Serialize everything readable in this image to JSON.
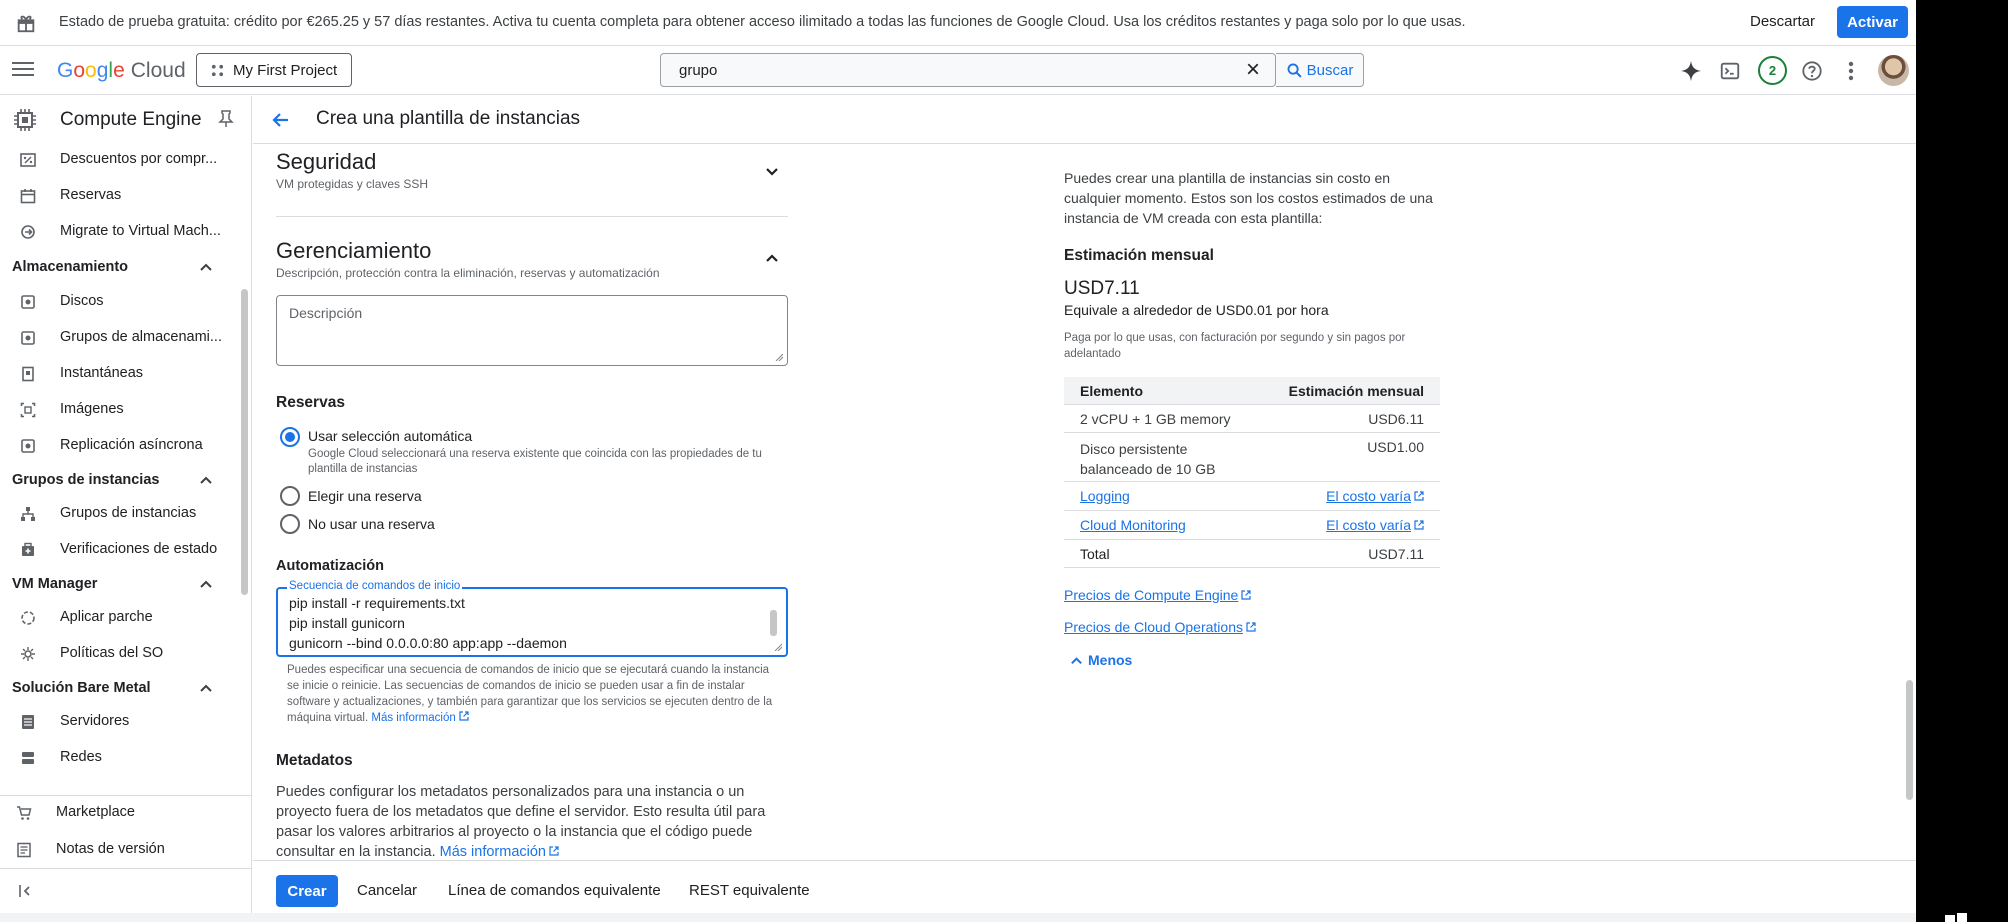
{
  "banner": {
    "message": "Estado de prueba gratuita: crédito por €265.25 y 57 días restantes. Activa tu cuenta completa para obtener acceso ilimitado a todas las funciones de Google Cloud. Usa los créditos restantes y paga solo por lo que usas.",
    "dismiss_label": "Descartar",
    "activate_label": "Activar"
  },
  "header": {
    "logo_google": [
      "G",
      "o",
      "o",
      "g",
      "l",
      "e"
    ],
    "logo_cloud": "Cloud",
    "project": "My First Project",
    "search_value": "grupo",
    "search_button": "Buscar",
    "notification_count": "2"
  },
  "sidebar": {
    "product": "Compute Engine",
    "items": [
      {
        "label": "Descuentos por compr...",
        "icon": "percent-icon"
      },
      {
        "label": "Reservas",
        "icon": "calendar-icon"
      },
      {
        "label": "Migrate to Virtual Mach...",
        "icon": "migrate-icon"
      }
    ],
    "sections": [
      {
        "title": "Almacenamiento",
        "items": [
          {
            "label": "Discos",
            "icon": "disk-icon"
          },
          {
            "label": "Grupos de almacenami...",
            "icon": "storage-pool-icon"
          },
          {
            "label": "Instantáneas",
            "icon": "snapshot-icon"
          },
          {
            "label": "Imágenes",
            "icon": "image-icon"
          },
          {
            "label": "Replicación asíncrona",
            "icon": "replication-icon"
          }
        ]
      },
      {
        "title": "Grupos de instancias",
        "items": [
          {
            "label": "Grupos de instancias",
            "icon": "instance-group-icon"
          },
          {
            "label": "Verificaciones de estado",
            "icon": "health-check-icon"
          }
        ]
      },
      {
        "title": "VM Manager",
        "items": [
          {
            "label": "Aplicar parche",
            "icon": "patch-icon"
          },
          {
            "label": "Políticas del SO",
            "icon": "os-policy-icon"
          }
        ]
      },
      {
        "title": "Solución Bare Metal",
        "items": [
          {
            "label": "Servidores",
            "icon": "server-icon"
          },
          {
            "label": "Redes",
            "icon": "network-icon"
          }
        ]
      }
    ],
    "marketplace": "Marketplace",
    "release_notes": "Notas de versión"
  },
  "page": {
    "title": "Crea una plantilla de instancias"
  },
  "form": {
    "security_title": "Seguridad",
    "security_sub": "VM protegidas y claves SSH",
    "management_title": "Gerenciamiento",
    "management_sub": "Descripción, protección contra la eliminación, reservas y automatización",
    "description_placeholder": "Descripción",
    "reservations_label": "Reservas",
    "radio_auto": "Usar selección automática",
    "radio_auto_hint": "Google Cloud seleccionará una reserva existente que coincida con las propiedades de tu plantilla de instancias",
    "radio_choose": "Elegir una reserva",
    "radio_none": "No usar una reserva",
    "automation_label": "Automatización",
    "startup_label": "Secuencia de comandos de inicio",
    "script_lines": [
      "pip install -r requirements.txt",
      "pip install gunicorn",
      "gunicorn --bind 0.0.0.0:80 app:app --daemon"
    ],
    "startup_hint": "Puedes especificar una secuencia de comandos de inicio que se ejecutará cuando la instancia se inicie o reinicie. Las secuencias de comandos de inicio se pueden usar a fin de instalar software y actualizaciones, y también para garantizar que los servicios se ejecuten dentro de la máquina virtual.",
    "more_info": "Más información",
    "metadata_title": "Metadatos",
    "metadata_text": "Puedes configurar los metadatos personalizados para una instancia o un proyecto fuera de los metadatos que define el servidor. Esto resulta útil para pasar los valores arbitrarios al proyecto o la instancia que el código puede consultar en la instancia."
  },
  "cost": {
    "intro": "Puedes crear una plantilla de instancias sin costo en cualquier momento. Estos son los costos estimados de una instancia de VM creada con esta plantilla:",
    "monthly_heading": "Estimación mensual",
    "price": "USD7.11",
    "hourly": "Equivale a alrededor de USD0.01 por hora",
    "note": "Paga por lo que usas, con facturación por segundo y sin pagos por adelantado",
    "table_headers": [
      "Elemento",
      "Estimación mensual"
    ],
    "rows": [
      {
        "item": "2 vCPU + 1 GB memory",
        "cost": "USD6.11"
      },
      {
        "item": "Disco persistente balanceado de 10 GB",
        "cost": "USD1.00"
      },
      {
        "item": "Logging",
        "cost": "El costo varía"
      },
      {
        "item": "Cloud Monitoring",
        "cost": "El costo varía"
      }
    ],
    "total_label": "Total",
    "total_value": "USD7.11",
    "link_compute": "Precios de Compute Engine",
    "link_operations": "Precios de Cloud Operations",
    "less_label": "Menos"
  },
  "footer": {
    "create": "Crear",
    "cancel": "Cancelar",
    "cli": "Línea de comandos equivalente",
    "rest": "REST equivalente"
  },
  "colors": {
    "accent": "#1a73e8",
    "status_green": "#188038"
  }
}
